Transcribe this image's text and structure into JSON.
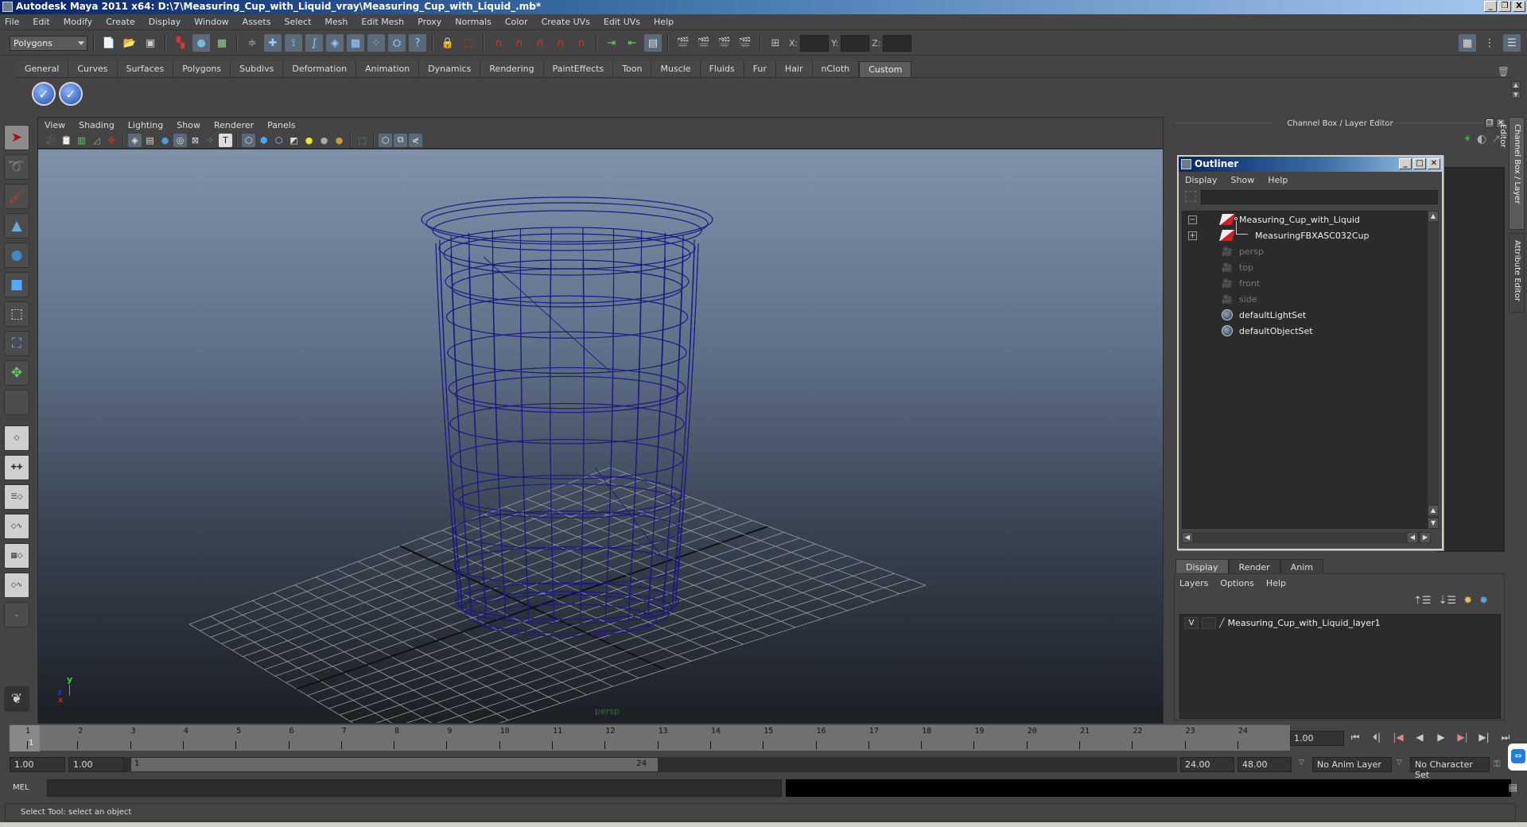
{
  "window": {
    "title": "Autodesk Maya 2011 x64: D:\\7\\Measuring_Cup_with_Liquid_vray\\Measuring_Cup_with_Liquid_.mb*",
    "controls": [
      "_",
      "❐",
      "X"
    ]
  },
  "menubar": [
    "File",
    "Edit",
    "Modify",
    "Create",
    "Display",
    "Window",
    "Assets",
    "Select",
    "Mesh",
    "Edit Mesh",
    "Proxy",
    "Normals",
    "Color",
    "Create UVs",
    "Edit UVs",
    "Help"
  ],
  "statusline": {
    "menu_set": "Polygons",
    "icons": [
      "new-scene-icon",
      "open-scene-icon",
      "save-scene-icon",
      "select-hierarchy-icon",
      "select-object-icon",
      "select-component-icon",
      "snap-grid-icon",
      "snap-curve-icon",
      "snap-point-icon",
      "snap-view-plane-icon",
      "make-live-icon",
      "lock-icon",
      "history-icon",
      "render-icon",
      "ipr-icon",
      "render-settings-icon",
      "hypershade-icon"
    ],
    "xyz_labels": [
      "X:",
      "Y:",
      "Z:"
    ]
  },
  "shelf": {
    "tabs": [
      "General",
      "Curves",
      "Surfaces",
      "Polygons",
      "Subdivs",
      "Deformation",
      "Animation",
      "Dynamics",
      "Rendering",
      "PaintEffects",
      "Toon",
      "Muscle",
      "Fluids",
      "Fur",
      "Hair",
      "nCloth",
      "Custom"
    ],
    "active_tab": "Custom",
    "buttons": [
      "custom-check-button-1",
      "custom-check-button-2"
    ]
  },
  "toolbox": [
    "select-tool",
    "lasso-tool",
    "paint-select-tool",
    "move-tool",
    "rotate-tool",
    "scale-tool",
    "universal-manipulator",
    "soft-mod-tool",
    "show-manipulator",
    "last-tool"
  ],
  "viewport": {
    "menu": [
      "View",
      "Shading",
      "Lighting",
      "Show",
      "Renderer",
      "Panels"
    ],
    "camera_label": "persp",
    "axis": {
      "x": "x",
      "y": "y",
      "z": "z"
    },
    "wire_color": "#1a1a80"
  },
  "channel_box": {
    "header": "Channel Box / Layer Editor",
    "side_tabs": [
      "Channel Box / Layer Editor",
      "Attribute Editor"
    ]
  },
  "outliner": {
    "title": "Outliner",
    "menu": [
      "Display",
      "Show",
      "Help"
    ],
    "filter_value": "",
    "items": [
      {
        "label": "Measuring_Cup_with_Liquid",
        "type": "transform",
        "expander": "−",
        "dim": false
      },
      {
        "label": "MeasuringFBXASC032Cup",
        "type": "transform",
        "expander": "+",
        "dim": false
      },
      {
        "label": "persp",
        "type": "camera",
        "dim": true
      },
      {
        "label": "top",
        "type": "camera",
        "dim": true
      },
      {
        "label": "front",
        "type": "camera",
        "dim": true
      },
      {
        "label": "side",
        "type": "camera",
        "dim": true
      },
      {
        "label": "defaultLightSet",
        "type": "set",
        "dim": false
      },
      {
        "label": "defaultObjectSet",
        "type": "set",
        "dim": false
      }
    ]
  },
  "layer_editor": {
    "tabs": [
      "Display",
      "Render",
      "Anim"
    ],
    "active_tab": "Display",
    "menu": [
      "Layers",
      "Options",
      "Help"
    ],
    "layers": [
      {
        "visible": "V",
        "name": "Measuring_Cup_with_Liquid_layer1"
      }
    ]
  },
  "timeline": {
    "start": 1,
    "end": 24,
    "current_frame": 1,
    "current_frame_field": "1.00",
    "frames": [
      "1",
      "2",
      "3",
      "4",
      "5",
      "6",
      "7",
      "8",
      "9",
      "10",
      "11",
      "12",
      "13",
      "14",
      "15",
      "16",
      "17",
      "18",
      "19",
      "20",
      "21",
      "22",
      "23",
      "24"
    ]
  },
  "range": {
    "start_time": "1.00",
    "playback_start": "1.00",
    "slider_start": "1",
    "slider_end": "24",
    "playback_end": "24.00",
    "end_time": "48.00",
    "anim_layer": "No Anim Layer",
    "character_set": "No Character Set"
  },
  "playback_controls": [
    "go-to-start",
    "step-back-key",
    "step-back-frame",
    "play-backward",
    "play-forward",
    "step-forward-frame",
    "step-forward-key",
    "go-to-end"
  ],
  "command_line": {
    "label": "MEL",
    "value": ""
  },
  "help_line": "Select Tool: select an object"
}
